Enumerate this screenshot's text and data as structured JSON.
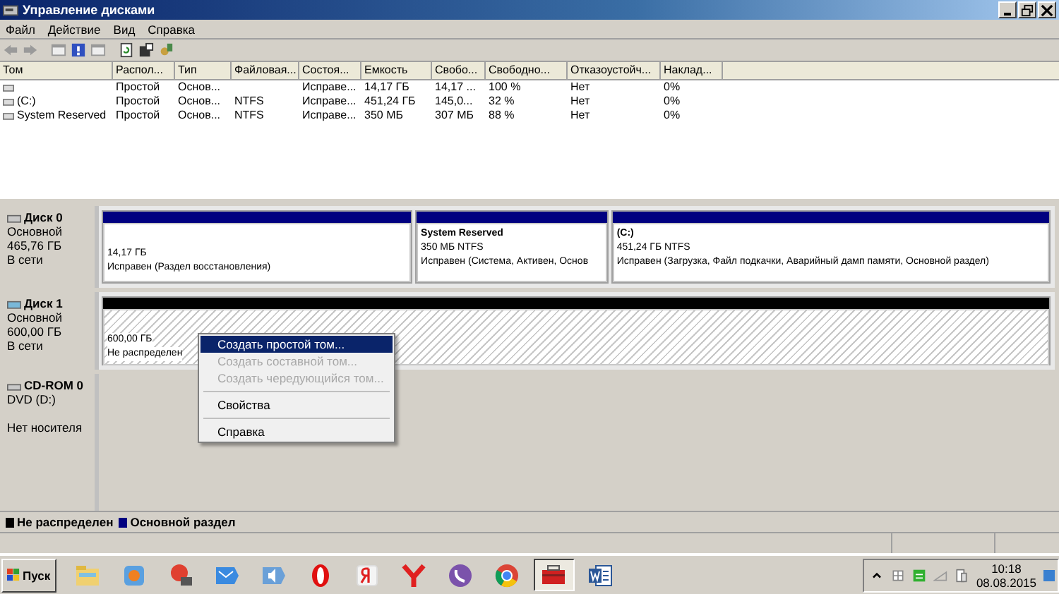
{
  "window": {
    "title": "Управление дисками"
  },
  "menu": [
    "Файл",
    "Действие",
    "Вид",
    "Справка"
  ],
  "volumes": {
    "columns": [
      "Том",
      "Распол...",
      "Тип",
      "Файловая...",
      "Состоя...",
      "Емкость",
      "Свобо...",
      "Свободно...",
      "Отказоустойч...",
      "Наклад..."
    ],
    "rows": [
      [
        "",
        "Простой",
        "Основ...",
        "",
        "Исправе...",
        "14,17 ГБ",
        "14,17 ...",
        "100 %",
        "Нет",
        "0%"
      ],
      [
        "(C:)",
        "Простой",
        "Основ...",
        "NTFS",
        "Исправе...",
        "451,24 ГБ",
        "145,0...",
        "32 %",
        "Нет",
        "0%"
      ],
      [
        "System Reserved",
        "Простой",
        "Основ...",
        "NTFS",
        "Исправе...",
        "350 МБ",
        "307 МБ",
        "88 %",
        "Нет",
        "0%"
      ]
    ]
  },
  "disks": [
    {
      "name": "Диск 0",
      "lines": [
        "Основной",
        "465,76 ГБ",
        "В сети"
      ],
      "kind": "disk",
      "partitions": [
        {
          "kind": "primary",
          "size": "14,17 ГБ",
          "status": "Исправен (Раздел восстановления)"
        },
        {
          "kind": "primary",
          "title": "System Reserved",
          "size": "350 МБ NTFS",
          "status": "Исправен (Система, Активен, Основ"
        },
        {
          "kind": "primary",
          "title": "(C:)",
          "size": "451,24 ГБ NTFS",
          "status": "Исправен (Загрузка, Файл подкачки, Аварийный дамп памяти, Основной раздел)"
        }
      ]
    },
    {
      "name": "Диск 1",
      "lines": [
        "Основной",
        "600,00 ГБ",
        "В сети"
      ],
      "kind": "disk",
      "partitions": [
        {
          "kind": "unallocated",
          "size": "600,00 ГБ",
          "status": "Не распределен"
        }
      ]
    },
    {
      "name": "CD-ROM 0",
      "lines": [
        "DVD (D:)",
        "Нет носителя"
      ],
      "kind": "cdrom"
    }
  ],
  "context_menu": [
    {
      "kind": "item",
      "label": "Создать простой том...",
      "disabled": false,
      "selected": true
    },
    {
      "kind": "item",
      "label": "Создать составной том...",
      "disabled": true,
      "selected": false
    },
    {
      "kind": "item",
      "label": "Создать чередующийся том...",
      "disabled": true,
      "selected": false
    },
    {
      "kind": "separator"
    },
    {
      "kind": "item",
      "label": "Свойства",
      "disabled": false,
      "selected": false
    },
    {
      "kind": "separator"
    },
    {
      "kind": "item",
      "label": "Справка",
      "disabled": false,
      "selected": false
    }
  ],
  "legend": [
    {
      "label": "Не распределен",
      "color": "#000000"
    },
    {
      "label": "Основной раздел",
      "color": "#000080"
    }
  ],
  "taskbar": {
    "start": "Пуск",
    "apps": [
      {
        "selected": false
      },
      {
        "selected": false
      },
      {
        "selected": false
      },
      {
        "selected": false
      },
      {
        "selected": false
      },
      {
        "selected": false
      },
      {
        "selected": false
      },
      {
        "selected": false
      },
      {
        "selected": false
      },
      {
        "selected": false
      },
      {
        "selected": true
      },
      {
        "selected": false
      }
    ],
    "time": "10:18",
    "date": "08.08.2015"
  }
}
